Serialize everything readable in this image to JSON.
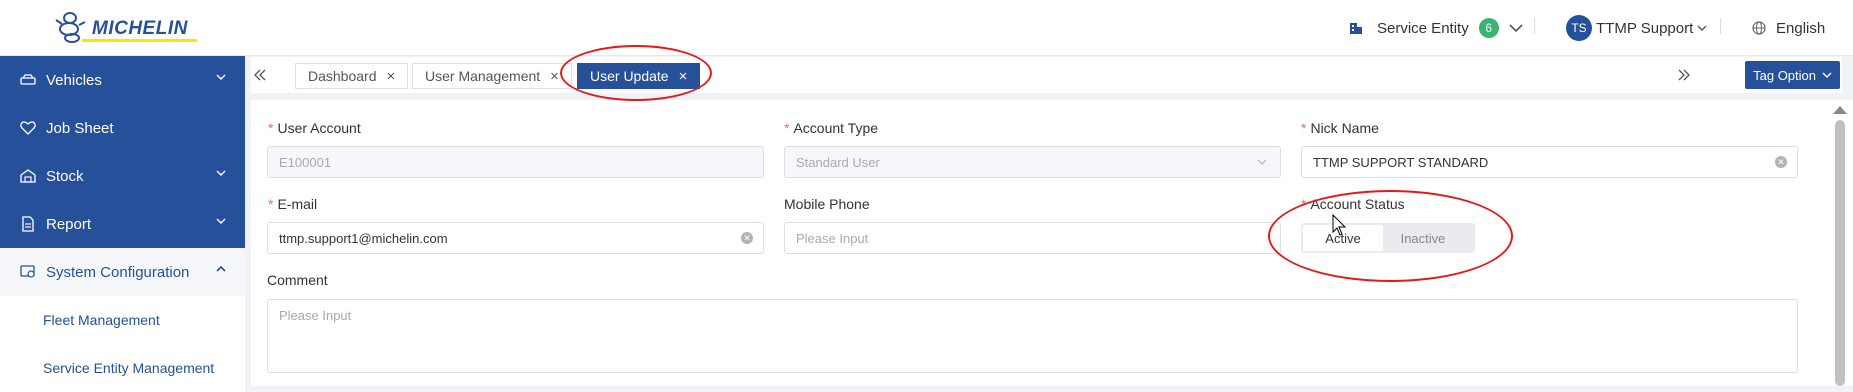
{
  "brand": {
    "name": "MICHELIN"
  },
  "header": {
    "service_entity_label": "Service Entity",
    "service_entity_count": "6",
    "user_initials": "TS",
    "user_name": "TTMP Support",
    "language": "English"
  },
  "sidebar": {
    "items": [
      {
        "label": "Vehicles",
        "icon": "car-icon"
      },
      {
        "label": "Job Sheet",
        "icon": "heart-icon"
      },
      {
        "label": "Stock",
        "icon": "warehouse-icon"
      },
      {
        "label": "Report",
        "icon": "document-icon"
      },
      {
        "label": "System Configuration",
        "icon": "settings-monitor-icon"
      }
    ],
    "subitems": [
      {
        "label": "Fleet Management"
      },
      {
        "label": "Service Entity Management"
      }
    ]
  },
  "tabs": [
    {
      "label": "Dashboard"
    },
    {
      "label": "User Management"
    },
    {
      "label": "User Update"
    }
  ],
  "tag_option_label": "Tag Option",
  "form": {
    "user_account": {
      "label": "User Account",
      "value": "E100001"
    },
    "account_type": {
      "label": "Account Type",
      "value": "Standard User"
    },
    "nick_name": {
      "label": "Nick Name",
      "value": "TTMP SUPPORT STANDARD"
    },
    "email": {
      "label": "E-mail",
      "value": "ttmp.support1@michelin.com"
    },
    "mobile_phone": {
      "label": "Mobile Phone",
      "placeholder": "Please Input"
    },
    "account_status": {
      "label": "Account Status",
      "active": "Active",
      "inactive": "Inactive",
      "selected": "Active"
    },
    "comment": {
      "label": "Comment",
      "placeholder": "Please Input"
    }
  },
  "colors": {
    "brand": "#27509b",
    "required": "#f56c6c",
    "annotation": "#e5181a",
    "badge": "#3cb371"
  }
}
